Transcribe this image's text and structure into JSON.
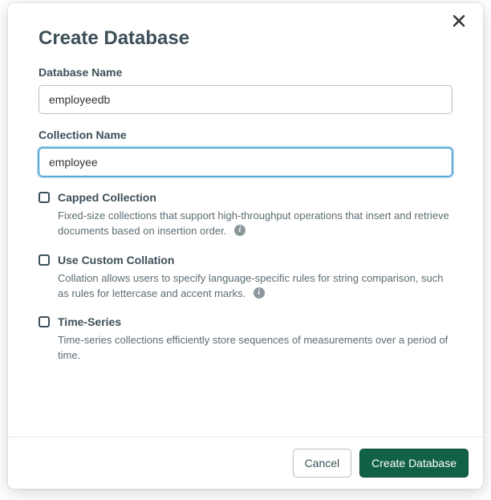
{
  "modal": {
    "title": "Create Database",
    "fields": {
      "database_name": {
        "label": "Database Name",
        "value": "employeedb"
      },
      "collection_name": {
        "label": "Collection Name",
        "value": "employee"
      }
    },
    "options": {
      "capped": {
        "title": "Capped Collection",
        "desc": "Fixed-size collections that support high-throughput operations that insert and retrieve documents based on insertion order.",
        "has_info": true
      },
      "collation": {
        "title": "Use Custom Collation",
        "desc": "Collation allows users to specify language-specific rules for string comparison, such as rules for lettercase and accent marks.",
        "has_info": true
      },
      "timeseries": {
        "title": "Time-Series",
        "desc": "Time-series collections efficiently store sequences of measurements over a period of time.",
        "has_info": false
      }
    },
    "buttons": {
      "cancel": "Cancel",
      "create": "Create Database"
    },
    "info_glyph": "i"
  }
}
